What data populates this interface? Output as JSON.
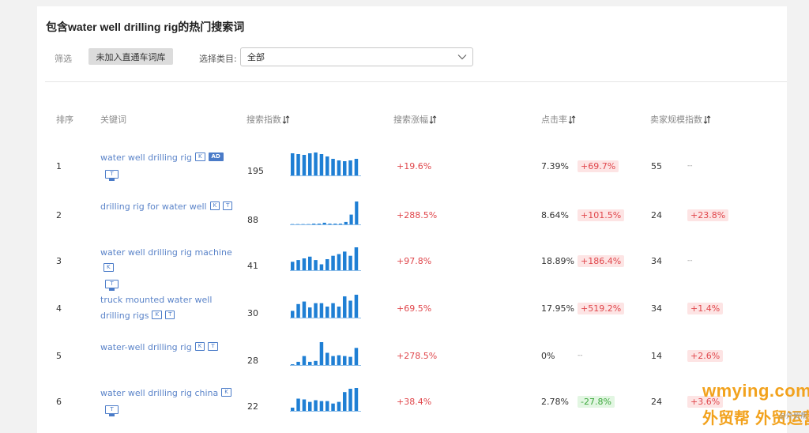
{
  "page": {
    "title": "包含water well drilling rig的热门搜索词"
  },
  "filter": {
    "label": "筛选",
    "chip_label": "未加入直通车词库",
    "category_label": "选择类目:",
    "category_value": "全部"
  },
  "table": {
    "headers": {
      "rank": "排序",
      "keyword": "关键词",
      "search_index": "搜索指数",
      "search_growth": "搜索涨幅",
      "ctr": "点击率",
      "seller_scale": "卖家规模指数"
    },
    "rows": [
      {
        "rank": "1",
        "keyword": "water well drilling rig",
        "badges": [
          "K",
          "AD"
        ],
        "tbadge": "T",
        "index": "195",
        "trend": [
          28,
          27,
          26,
          28,
          29,
          27,
          24,
          21,
          19,
          18,
          19,
          21
        ],
        "growth": "+19.6%",
        "ctr": "7.39%",
        "ctr_change": "+69.7%",
        "ctr_dir": "up",
        "seller": "55",
        "seller_change": "--",
        "seller_dir": "none"
      },
      {
        "rank": "2",
        "keyword": "drilling rig for water well",
        "badges": [
          "K",
          "T"
        ],
        "tbadge": "",
        "index": "88",
        "trend": [
          0,
          0,
          0,
          0,
          1,
          1,
          2,
          1,
          1,
          1,
          3,
          12,
          28
        ],
        "growth": "+288.5%",
        "ctr": "8.64%",
        "ctr_change": "+101.5%",
        "ctr_dir": "up",
        "seller": "24",
        "seller_change": "+23.8%",
        "seller_dir": "up"
      },
      {
        "rank": "3",
        "keyword": "water well drilling rig machine",
        "badges": [
          "K"
        ],
        "tbadge": "T",
        "index": "41",
        "trend": [
          10,
          12,
          14,
          16,
          12,
          7,
          13,
          17,
          19,
          22,
          17,
          27
        ],
        "growth": "+97.8%",
        "ctr": "18.89%",
        "ctr_change": "+186.4%",
        "ctr_dir": "up",
        "seller": "34",
        "seller_change": "--",
        "seller_dir": "none"
      },
      {
        "rank": "4",
        "keyword": "truck mounted water well drilling rigs",
        "badges": [
          "K",
          "T"
        ],
        "tbadge": "",
        "index": "30",
        "trend": [
          8,
          16,
          19,
          12,
          17,
          17,
          13,
          17,
          13,
          25,
          20,
          27
        ],
        "growth": "+69.5%",
        "ctr": "17.95%",
        "ctr_change": "+519.2%",
        "ctr_dir": "up",
        "seller": "34",
        "seller_change": "+1.4%",
        "seller_dir": "up"
      },
      {
        "rank": "5",
        "keyword": "water-well drilling rig",
        "badges": [
          "K",
          "T"
        ],
        "tbadge": "",
        "index": "28",
        "trend": [
          1,
          4,
          11,
          4,
          5,
          28,
          15,
          11,
          12,
          11,
          10,
          21
        ],
        "growth": "+278.5%",
        "ctr": "0%",
        "ctr_change": "--",
        "ctr_dir": "none",
        "seller": "14",
        "seller_change": "+2.6%",
        "seller_dir": "up"
      },
      {
        "rank": "6",
        "keyword": "water well drilling rig china",
        "badges": [
          "K"
        ],
        "tbadge": "T",
        "index": "22",
        "trend": [
          4,
          15,
          14,
          11,
          13,
          12,
          12,
          9,
          11,
          23,
          27,
          28
        ],
        "growth": "+38.4%",
        "ctr": "2.78%",
        "ctr_change": "-27.8%",
        "ctr_dir": "down",
        "seller": "24",
        "seller_change": "+3.6%",
        "seller_dir": "up"
      }
    ]
  },
  "watermark": {
    "line1": "wmying.com",
    "line2": "外贸帮 外贸运营",
    "mark": "@外贸帮"
  },
  "colors": {
    "bar": "#1f7fd4",
    "link": "#5b84c9",
    "up": "#e0474c",
    "down": "#3da83d",
    "watermark": "#f2a21d"
  }
}
